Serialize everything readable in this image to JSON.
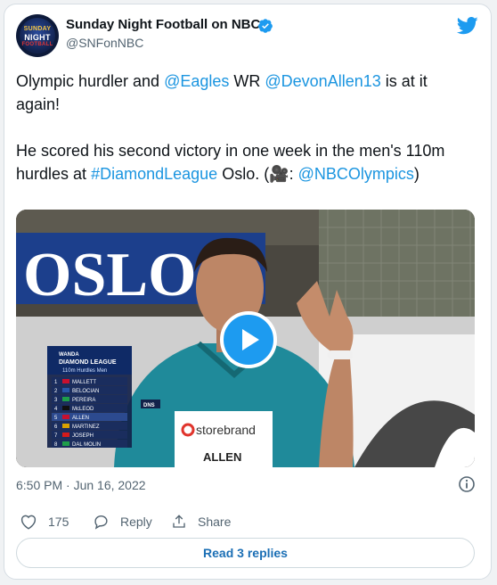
{
  "tweet": {
    "author_name": "Sunday Night Football on NBC",
    "author_handle": "@SNFonNBC",
    "avatar_text": [
      "SUNDAY",
      "NIGHT",
      "FOOTBALL"
    ],
    "line1_pre": "Olympic hurdler and ",
    "mention_eagles": "@Eagles",
    "line1_mid": " WR ",
    "mention_devon": "@DevonAllen13",
    "line1_post": " is at it again!",
    "line2_pre": "He scored his second victory in one week in the men's 110m hurdles at ",
    "hashtag": "#DiamondLeague",
    "line2_post": " Oslo. (",
    "camera_emoji": "🎥",
    "line2_end": ": ",
    "mention_nbc": "@NBCOlympics",
    "close_paren": ")",
    "timestamp": "6:50 PM · Jun 16, 2022",
    "like_count": "175",
    "reply_label": "Reply",
    "share_label": "Share",
    "read_replies": "Read 3 replies"
  },
  "video": {
    "banner": "OSLO",
    "scoreboard_title1": "WANDA",
    "scoreboard_title2": "DIAMOND LEAGUE",
    "scoreboard_event": "110m Hurdles Men",
    "results": [
      {
        "pos": "1",
        "name": "MALLETT"
      },
      {
        "pos": "2",
        "name": "BELOCIAN"
      },
      {
        "pos": "3",
        "name": "PEREIRA"
      },
      {
        "pos": "4",
        "name": "McLEOD"
      },
      {
        "pos": "5",
        "name": "ALLEN"
      },
      {
        "pos": "6",
        "name": "MARTINEZ"
      },
      {
        "pos": "7",
        "name": "JOSEPH"
      },
      {
        "pos": "8",
        "name": "DAL MOLIN"
      }
    ],
    "dns": "DNS",
    "bib_sponsor": "storebrand",
    "bib_name": "ALLEN"
  },
  "colors": {
    "link": "#1b95e0",
    "twitter_blue": "#1d9bf0",
    "text": "#0f1419",
    "muted": "#536471"
  }
}
